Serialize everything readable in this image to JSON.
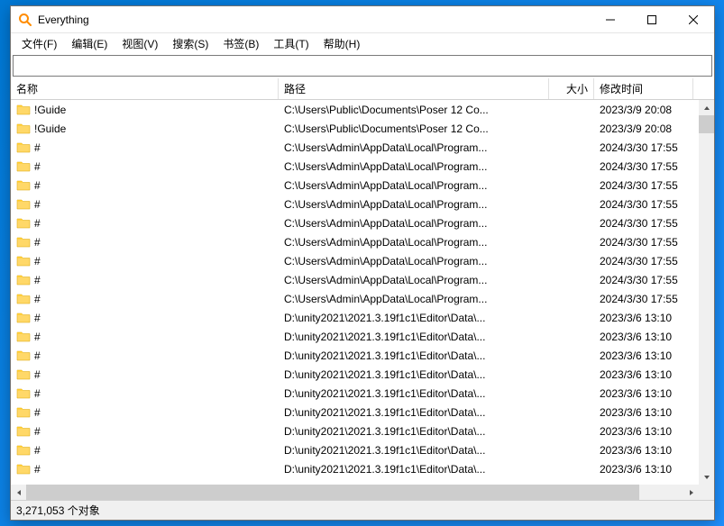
{
  "window": {
    "title": "Everything"
  },
  "menu": {
    "file": "文件(F)",
    "edit": "编辑(E)",
    "view": "视图(V)",
    "search": "搜索(S)",
    "bookmark": "书签(B)",
    "tools": "工具(T)",
    "help": "帮助(H)"
  },
  "search_input": {
    "value": ""
  },
  "columns": {
    "name": "名称",
    "path": "路径",
    "size": "大小",
    "date": "修改时间"
  },
  "rows": [
    {
      "name": "!Guide",
      "path": "C:\\Users\\Public\\Documents\\Poser 12 Co...",
      "size": "",
      "date": "2023/3/9 20:08"
    },
    {
      "name": "!Guide",
      "path": "C:\\Users\\Public\\Documents\\Poser 12 Co...",
      "size": "",
      "date": "2023/3/9 20:08"
    },
    {
      "name": "#",
      "path": "C:\\Users\\Admin\\AppData\\Local\\Program...",
      "size": "",
      "date": "2024/3/30 17:55"
    },
    {
      "name": "#",
      "path": "C:\\Users\\Admin\\AppData\\Local\\Program...",
      "size": "",
      "date": "2024/3/30 17:55"
    },
    {
      "name": "#",
      "path": "C:\\Users\\Admin\\AppData\\Local\\Program...",
      "size": "",
      "date": "2024/3/30 17:55"
    },
    {
      "name": "#",
      "path": "C:\\Users\\Admin\\AppData\\Local\\Program...",
      "size": "",
      "date": "2024/3/30 17:55"
    },
    {
      "name": "#",
      "path": "C:\\Users\\Admin\\AppData\\Local\\Program...",
      "size": "",
      "date": "2024/3/30 17:55"
    },
    {
      "name": "#",
      "path": "C:\\Users\\Admin\\AppData\\Local\\Program...",
      "size": "",
      "date": "2024/3/30 17:55"
    },
    {
      "name": "#",
      "path": "C:\\Users\\Admin\\AppData\\Local\\Program...",
      "size": "",
      "date": "2024/3/30 17:55"
    },
    {
      "name": "#",
      "path": "C:\\Users\\Admin\\AppData\\Local\\Program...",
      "size": "",
      "date": "2024/3/30 17:55"
    },
    {
      "name": "#",
      "path": "C:\\Users\\Admin\\AppData\\Local\\Program...",
      "size": "",
      "date": "2024/3/30 17:55"
    },
    {
      "name": "#",
      "path": "D:\\unity2021\\2021.3.19f1c1\\Editor\\Data\\...",
      "size": "",
      "date": "2023/3/6 13:10"
    },
    {
      "name": "#",
      "path": "D:\\unity2021\\2021.3.19f1c1\\Editor\\Data\\...",
      "size": "",
      "date": "2023/3/6 13:10"
    },
    {
      "name": "#",
      "path": "D:\\unity2021\\2021.3.19f1c1\\Editor\\Data\\...",
      "size": "",
      "date": "2023/3/6 13:10"
    },
    {
      "name": "#",
      "path": "D:\\unity2021\\2021.3.19f1c1\\Editor\\Data\\...",
      "size": "",
      "date": "2023/3/6 13:10"
    },
    {
      "name": "#",
      "path": "D:\\unity2021\\2021.3.19f1c1\\Editor\\Data\\...",
      "size": "",
      "date": "2023/3/6 13:10"
    },
    {
      "name": "#",
      "path": "D:\\unity2021\\2021.3.19f1c1\\Editor\\Data\\...",
      "size": "",
      "date": "2023/3/6 13:10"
    },
    {
      "name": "#",
      "path": "D:\\unity2021\\2021.3.19f1c1\\Editor\\Data\\...",
      "size": "",
      "date": "2023/3/6 13:10"
    },
    {
      "name": "#",
      "path": "D:\\unity2021\\2021.3.19f1c1\\Editor\\Data\\...",
      "size": "",
      "date": "2023/3/6 13:10"
    },
    {
      "name": "#",
      "path": "D:\\unity2021\\2021.3.19f1c1\\Editor\\Data\\...",
      "size": "",
      "date": "2023/3/6 13:10"
    }
  ],
  "statusbar": {
    "count": "3,271,053 个对象"
  }
}
